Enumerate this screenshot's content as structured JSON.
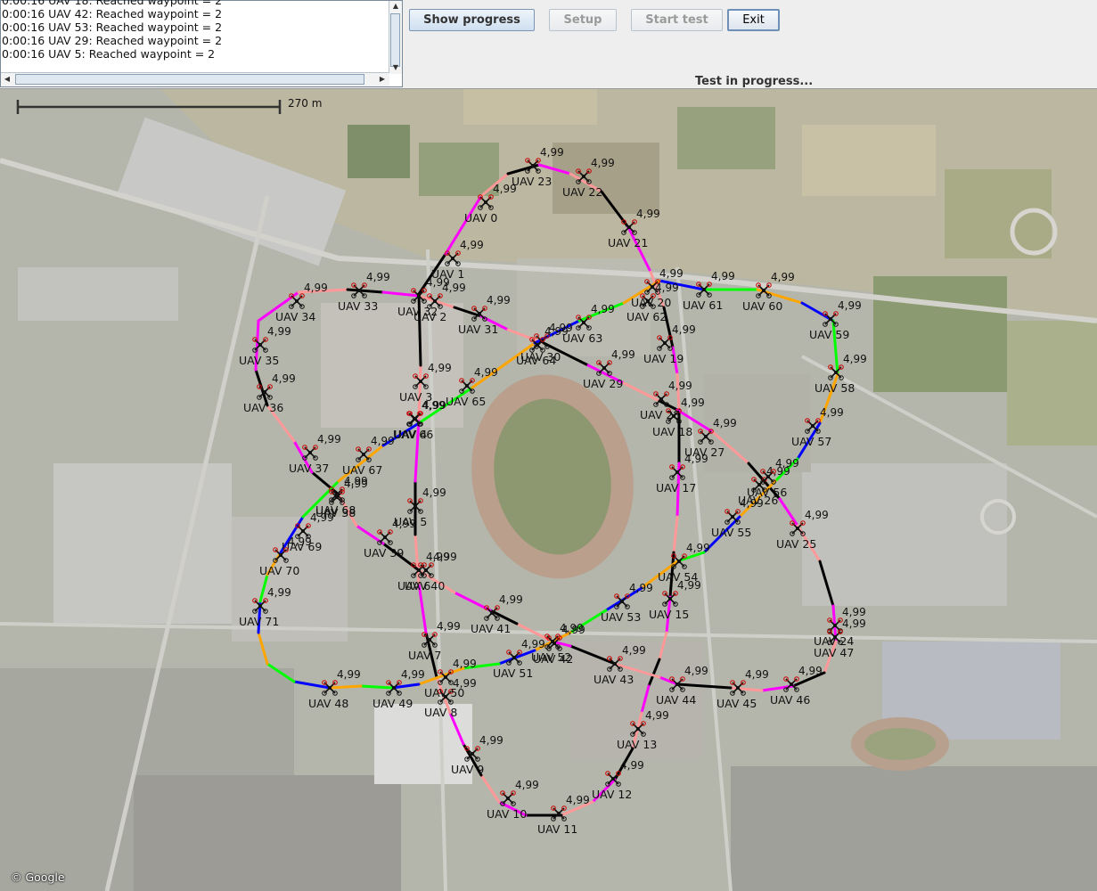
{
  "log": {
    "lines": [
      "0:00:16 UAV 18: Reached waypoint = 2",
      "0:00:16 UAV 42: Reached waypoint = 2",
      "0:00:16 UAV 53: Reached waypoint = 2",
      "0:00:16 UAV 29: Reached waypoint = 2",
      "0:00:16 UAV 5: Reached waypoint = 2"
    ]
  },
  "buttons": {
    "show_progress": "Show progress",
    "setup": "Setup",
    "start_test": "Start test",
    "exit": "Exit"
  },
  "status_text": "Test in progress...",
  "map": {
    "scale_label": "270 m",
    "attribution": "© Google",
    "speed_label": "4,99",
    "segment_colors": [
      "#ff0000",
      "#0000ff",
      "#000000",
      "#ffff00",
      "#00ff00",
      "#ff00ff",
      "#00e5ff",
      "#ffa500",
      "#ff9999"
    ]
  },
  "uavs": [
    {
      "name": "UAV 0"
    },
    {
      "name": "UAV 1"
    },
    {
      "name": "UAV 2"
    },
    {
      "name": "UAV 3"
    },
    {
      "name": "UAV 4"
    },
    {
      "name": "UAV 5"
    },
    {
      "name": "UAV 6"
    },
    {
      "name": "UAV 7"
    },
    {
      "name": "UAV 8"
    },
    {
      "name": "UAV 9"
    },
    {
      "name": "UAV 10"
    },
    {
      "name": "UAV 11"
    },
    {
      "name": "UAV 12"
    },
    {
      "name": "UAV 13"
    },
    {
      "name": "UAV 15"
    },
    {
      "name": "UAV 17"
    },
    {
      "name": "UAV 18"
    },
    {
      "name": "UAV 19"
    },
    {
      "name": "UAV 20"
    },
    {
      "name": "UAV 21"
    },
    {
      "name": "UAV 22"
    },
    {
      "name": "UAV 23"
    },
    {
      "name": "UAV 24"
    },
    {
      "name": "UAV 25"
    },
    {
      "name": "UAV 26"
    },
    {
      "name": "UAV 27"
    },
    {
      "name": "UAV 28"
    },
    {
      "name": "UAV 29"
    },
    {
      "name": "UAV 30"
    },
    {
      "name": "UAV 31"
    },
    {
      "name": "UAV 32"
    },
    {
      "name": "UAV 33"
    },
    {
      "name": "UAV 34"
    },
    {
      "name": "UAV 35"
    },
    {
      "name": "UAV 36"
    },
    {
      "name": "UAV 37"
    },
    {
      "name": "UAV 38"
    },
    {
      "name": "UAV 39"
    },
    {
      "name": "UAV 40"
    },
    {
      "name": "UAV 41"
    },
    {
      "name": "UAV 42"
    },
    {
      "name": "UAV 43"
    },
    {
      "name": "UAV 44"
    },
    {
      "name": "UAV 45"
    },
    {
      "name": "UAV 46"
    },
    {
      "name": "UAV 47"
    },
    {
      "name": "UAV 48"
    },
    {
      "name": "UAV 49"
    },
    {
      "name": "UAV 50"
    },
    {
      "name": "UAV 51"
    },
    {
      "name": "UAV 52"
    },
    {
      "name": "UAV 53"
    },
    {
      "name": "UAV 54"
    },
    {
      "name": "UAV 55"
    },
    {
      "name": "UAV 56"
    },
    {
      "name": "UAV 57"
    },
    {
      "name": "UAV 58"
    },
    {
      "name": "UAV 59"
    },
    {
      "name": "UAV 60"
    },
    {
      "name": "UAV 61"
    },
    {
      "name": "UAV 62"
    },
    {
      "name": "UAV 63"
    },
    {
      "name": "UAV 64"
    },
    {
      "name": "UAV 65"
    },
    {
      "name": "UAV 66"
    },
    {
      "name": "UAV 67"
    },
    {
      "name": "UAV 68"
    },
    {
      "name": "UAV 69"
    },
    {
      "name": "UAV 70"
    },
    {
      "name": "UAV 71"
    }
  ]
}
